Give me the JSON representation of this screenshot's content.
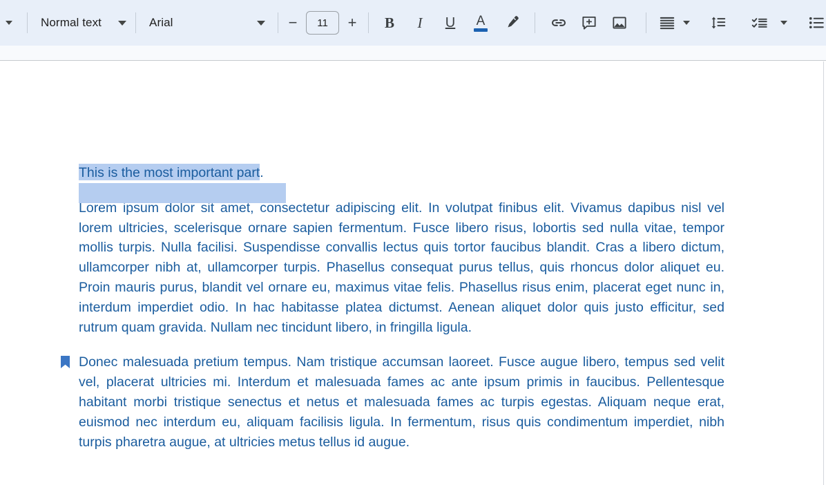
{
  "toolbar": {
    "overflow_caret": "more-options",
    "paragraph_style": "Normal text",
    "font_family": "Arial",
    "font_size": "11",
    "decrease_font_label": "−",
    "increase_font_label": "+",
    "bold_label": "B",
    "italic_label": "I",
    "underline_label": "U",
    "text_color_label": "A",
    "text_color_value": "#1b61b1",
    "icons": {
      "highlight": "highlight-pen-icon",
      "link": "link-icon",
      "comment": "add-comment-icon",
      "image": "insert-image-icon",
      "align": "align-justify-icon",
      "line_spacing": "line-spacing-icon",
      "checklist": "checklist-icon",
      "bulleted_list": "bulleted-list-icon"
    }
  },
  "document": {
    "heading": {
      "selected_text": "This is the most important part",
      "trailing_text": ".",
      "selection_color": "#b5cdf0"
    },
    "paragraphs": [
      "Lorem ipsum dolor sit amet, consectetur adipiscing elit. In volutpat finibus elit. Vivamus dapibus nisl vel lorem ultricies, scelerisque ornare sapien fermentum. Fusce libero risus, lobortis sed nulla vitae, tempor mollis turpis. Nulla facilisi. Suspendisse convallis lectus quis tortor faucibus blandit. Cras a libero dictum, ullamcorper nibh at, ullamcorper turpis. Phasellus consequat purus tellus, quis rhoncus dolor aliquet eu. Proin mauris purus, blandit vel ornare eu, maximus vitae felis. Phasellus risus enim, placerat eget nunc in, interdum imperdiet odio. In hac habitasse platea dictumst. Aenean aliquet dolor quis justo efficitur, sed rutrum quam gravida. Nullam nec tincidunt libero, in fringilla ligula.",
      "Donec malesuada pretium tempus. Nam tristique accumsan laoreet. Fusce augue libero, tempus sed velit vel, placerat ultricies mi. Interdum et malesuada fames ac ante ipsum primis in faucibus. Pellentesque habitant morbi tristique senectus et netus et malesuada fames ac turpis egestas. Aliquam neque erat, euismod nec interdum eu, aliquam facilisis ligula. In fermentum, risus quis condimentum imperdiet, nibh turpis pharetra augue, at ultricies metus tellus id augue."
    ],
    "text_color": "#1a5c9e",
    "bookmark_marker_color": "#3b76c4"
  }
}
